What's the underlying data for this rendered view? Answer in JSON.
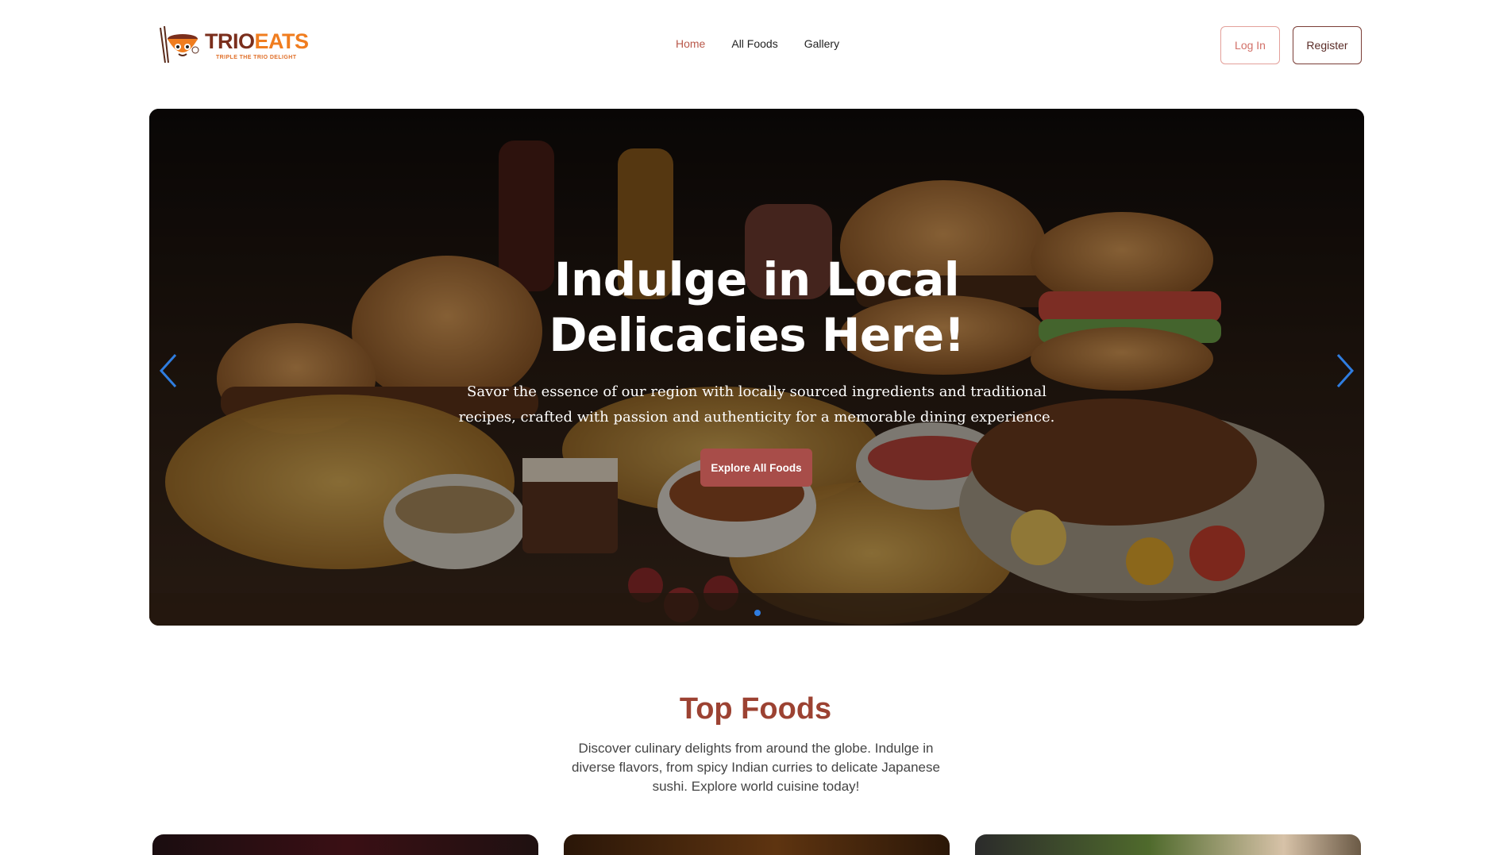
{
  "brand": {
    "word_part1": "TRIO",
    "word_part2": "EATS",
    "tagline": "TRIPLE THE TRIO DELIGHT"
  },
  "nav": {
    "items": [
      {
        "label": "Home",
        "active": true
      },
      {
        "label": "All Foods",
        "active": false
      },
      {
        "label": "Gallery",
        "active": false
      }
    ]
  },
  "auth": {
    "login_label": "Log In",
    "register_label": "Register"
  },
  "hero": {
    "title_line1": "Indulge in Local",
    "title_line2": "Delicacies Here!",
    "subtitle": "Savor the essence of our region with locally sourced ingredients and traditional recipes, crafted with passion and authenticity for a memorable dining experience.",
    "cta_label": "Explore All Foods"
  },
  "top_foods": {
    "title": "Top Foods",
    "description": "Discover culinary delights from around the globe. Indulge in diverse flavors, from spicy Indian curries to delicate Japanese sushi. Explore world cuisine today!"
  },
  "colors": {
    "accent": "#a84d49",
    "heading": "#9c4232",
    "nav_active": "#b9584a",
    "carousel_arrow": "#2f7de0"
  }
}
